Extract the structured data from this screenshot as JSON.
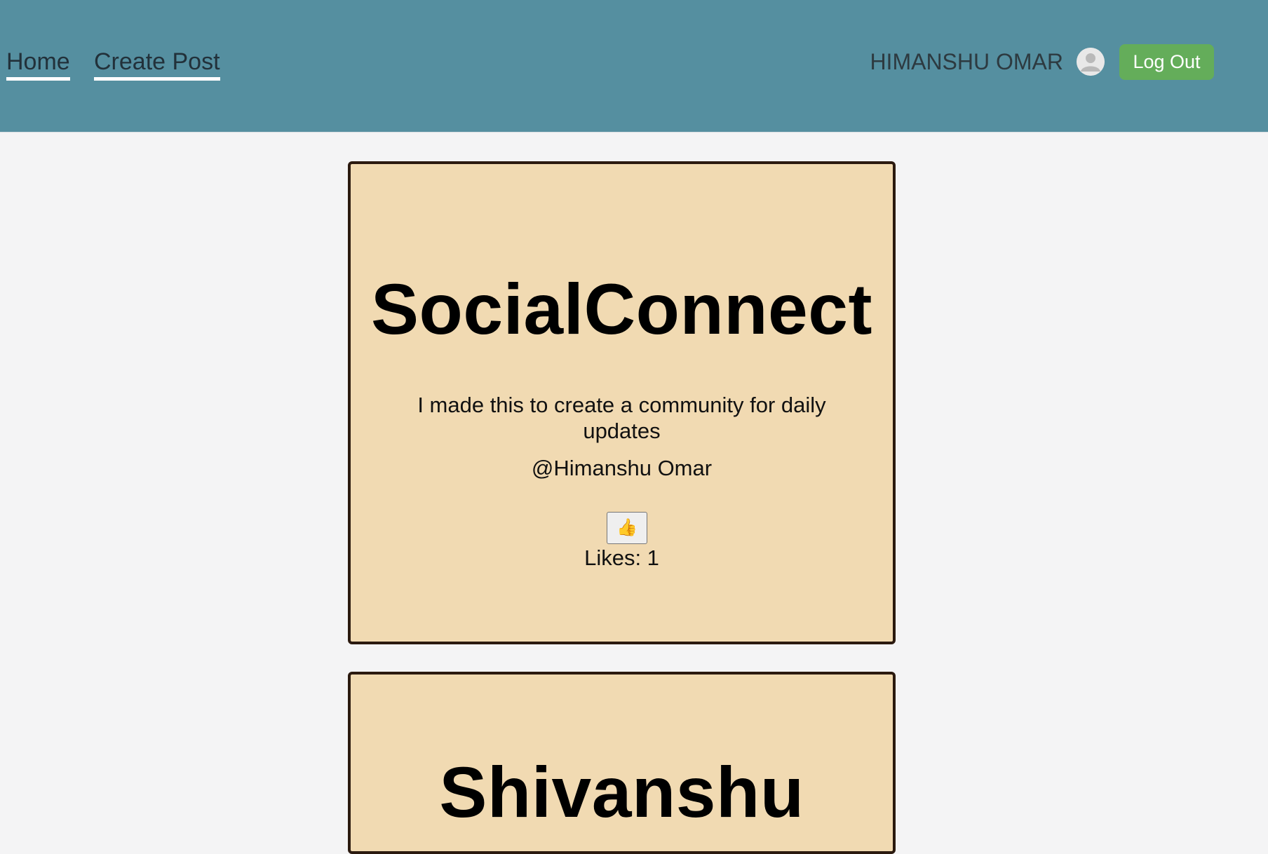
{
  "nav": {
    "home_label": "Home",
    "create_post_label": "Create Post",
    "user_name": "HIMANSHU OMAR",
    "logout_label": "Log Out"
  },
  "colors": {
    "navbar": "#558fa0",
    "page_background": "#f4f4f5",
    "card_background": "#f1dab2",
    "card_border": "#2b1a0f",
    "logout_button": "#64ad5a"
  },
  "posts": [
    {
      "title": "SocialConnect",
      "body": "I made this to create a community for daily updates",
      "author": "@Himanshu Omar",
      "like_icon": "👍",
      "likes_text": "Likes: 1"
    },
    {
      "title": "Shivanshu"
    }
  ],
  "icons": {
    "avatar": "user-avatar-icon",
    "like": "thumbs-up-icon"
  }
}
